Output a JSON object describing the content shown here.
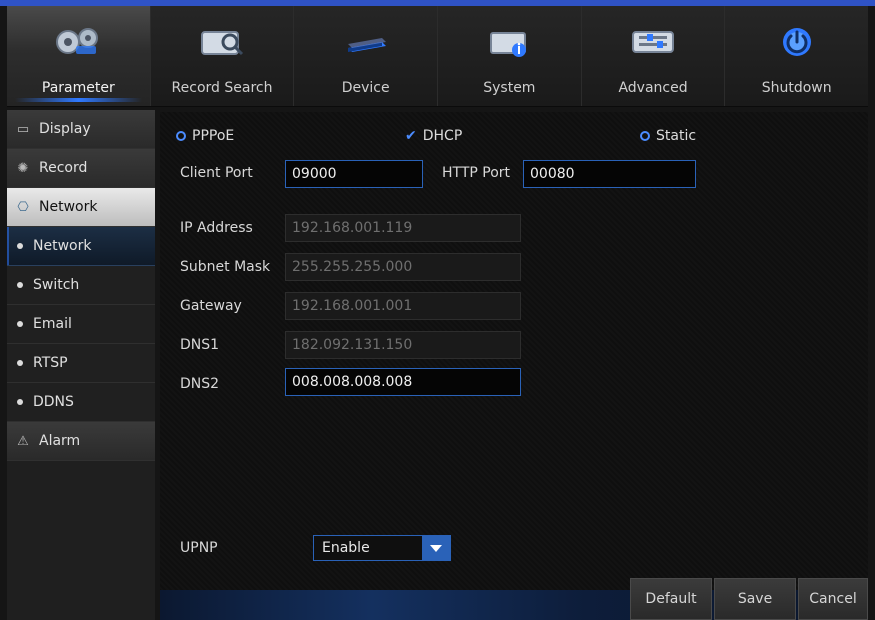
{
  "nav": {
    "tabs": [
      {
        "label": "Parameter",
        "icon": "gears-icon"
      },
      {
        "label": "Record Search",
        "icon": "record-search-icon"
      },
      {
        "label": "Device",
        "icon": "hard-drive-icon"
      },
      {
        "label": "System",
        "icon": "system-info-icon"
      },
      {
        "label": "Advanced",
        "icon": "advanced-settings-icon"
      },
      {
        "label": "Shutdown",
        "icon": "power-icon"
      }
    ],
    "active_index": 0
  },
  "sidebar": {
    "items": [
      {
        "type": "category",
        "label": "Display",
        "icon": "monitor-icon"
      },
      {
        "type": "category",
        "label": "Record",
        "icon": "film-reel-icon"
      },
      {
        "type": "category",
        "label": "Network",
        "icon": "network-icon",
        "selected": true
      },
      {
        "type": "sub",
        "label": "Network",
        "selected": true
      },
      {
        "type": "sub",
        "label": "Switch"
      },
      {
        "type": "sub",
        "label": "Email"
      },
      {
        "type": "sub",
        "label": "RTSP"
      },
      {
        "type": "sub",
        "label": "DDNS"
      },
      {
        "type": "category",
        "label": "Alarm",
        "icon": "alarm-icon"
      }
    ]
  },
  "network": {
    "modes": {
      "pppoe": "PPPoE",
      "dhcp": "DHCP",
      "static": "Static",
      "selected": "DHCP"
    },
    "client_port_label": "Client Port",
    "client_port_value": "09000",
    "http_port_label": "HTTP Port",
    "http_port_value": "00080",
    "ip_label": "IP Address",
    "ip_value": "192.168.001.119",
    "subnet_label": "Subnet Mask",
    "subnet_value": "255.255.255.000",
    "gateway_label": "Gateway",
    "gateway_value": "192.168.001.001",
    "dns1_label": "DNS1",
    "dns1_value": "182.092.131.150",
    "dns2_label": "DNS2",
    "dns2_value": "008.008.008.008",
    "upnp_label": "UPNP",
    "upnp_value": "Enable"
  },
  "buttons": {
    "default": "Default",
    "save": "Save",
    "cancel": "Cancel"
  },
  "colors": {
    "accent": "#2f79ff",
    "top_line": "#2f53c6"
  }
}
